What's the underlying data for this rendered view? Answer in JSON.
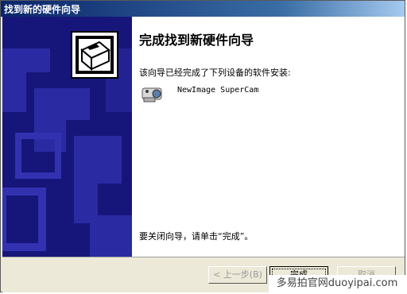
{
  "window": {
    "title": "找到新的硬件向导"
  },
  "content": {
    "heading": "完成找到新硬件向导",
    "description": "该向导已经完成了下列设备的软件安装:",
    "device_name": "NewImage SuperCam",
    "finish_instruction": "要关闭向导，请单击“完成”。"
  },
  "buttons": {
    "back": "< 上一步(B)",
    "finish": "完成",
    "cancel": "取消"
  },
  "watermark": "多易拍官网duoyipai.com"
}
